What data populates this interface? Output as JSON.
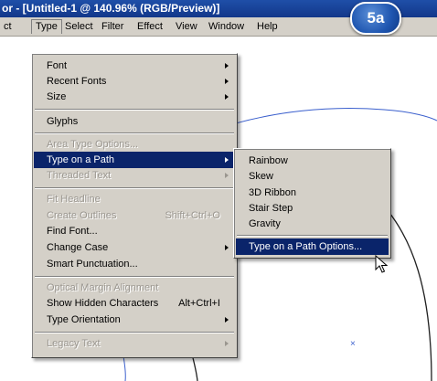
{
  "window": {
    "title": "or - [Untitled-1 @ 140.96% (RGB/Preview)]"
  },
  "badge": {
    "label": "5a"
  },
  "menubar": {
    "items": [
      "ct",
      "Type",
      "Select",
      "Filter",
      "Effect",
      "View",
      "Window",
      "Help"
    ],
    "active": "Type"
  },
  "type_menu": {
    "font": "Font",
    "recent_fonts": "Recent Fonts",
    "size": "Size",
    "glyphs": "Glyphs",
    "area_type_options": "Area Type Options...",
    "type_on_a_path": "Type on a Path",
    "threaded_text": "Threaded Text",
    "fit_headline": "Fit Headline",
    "create_outlines": "Create Outlines",
    "create_outlines_shortcut": "Shift+Ctrl+O",
    "find_font": "Find Font...",
    "change_case": "Change Case",
    "smart_punctuation": "Smart Punctuation...",
    "optical_margin_alignment": "Optical Margin Alignment",
    "show_hidden_characters": "Show Hidden Characters",
    "show_hidden_characters_shortcut": "Alt+Ctrl+I",
    "type_orientation": "Type Orientation",
    "legacy_text": "Legacy Text"
  },
  "submenu": {
    "rainbow": "Rainbow",
    "skew": "Skew",
    "ribbon_3d": "3D Ribbon",
    "stair_step": "Stair Step",
    "gravity": "Gravity",
    "options": "Type on a Path Options..."
  },
  "canvas": {
    "marker": "×"
  },
  "colors": {
    "highlight": "#0a246a",
    "menu_bg": "#d4d0c8",
    "title_bar": "#12378a",
    "path_blue": "#3a5fcd"
  }
}
